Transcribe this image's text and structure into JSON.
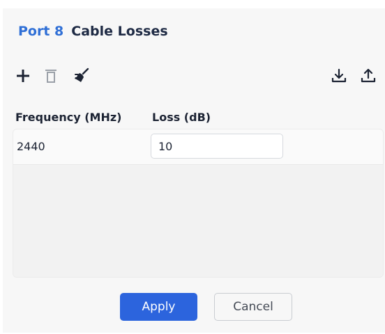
{
  "dialog": {
    "port_label": "Port 8",
    "title": "Cable Losses"
  },
  "toolbar": {
    "icons": [
      "add-icon",
      "delete-icon",
      "clear-icon",
      "download-icon",
      "upload-icon"
    ]
  },
  "table": {
    "columns": [
      "Frequency (MHz)",
      "Loss (dB)"
    ],
    "rows": [
      {
        "frequency": "2440",
        "loss": "10"
      }
    ]
  },
  "actions": {
    "apply_label": "Apply",
    "cancel_label": "Cancel"
  },
  "colors": {
    "accent": "#2c64dd",
    "port_label": "#2f6fd6",
    "title_text": "#1e2a44",
    "dialog_bg": "#f7f7f7",
    "icon_dark": "#1c2333",
    "icon_muted": "#9aa0a8"
  }
}
